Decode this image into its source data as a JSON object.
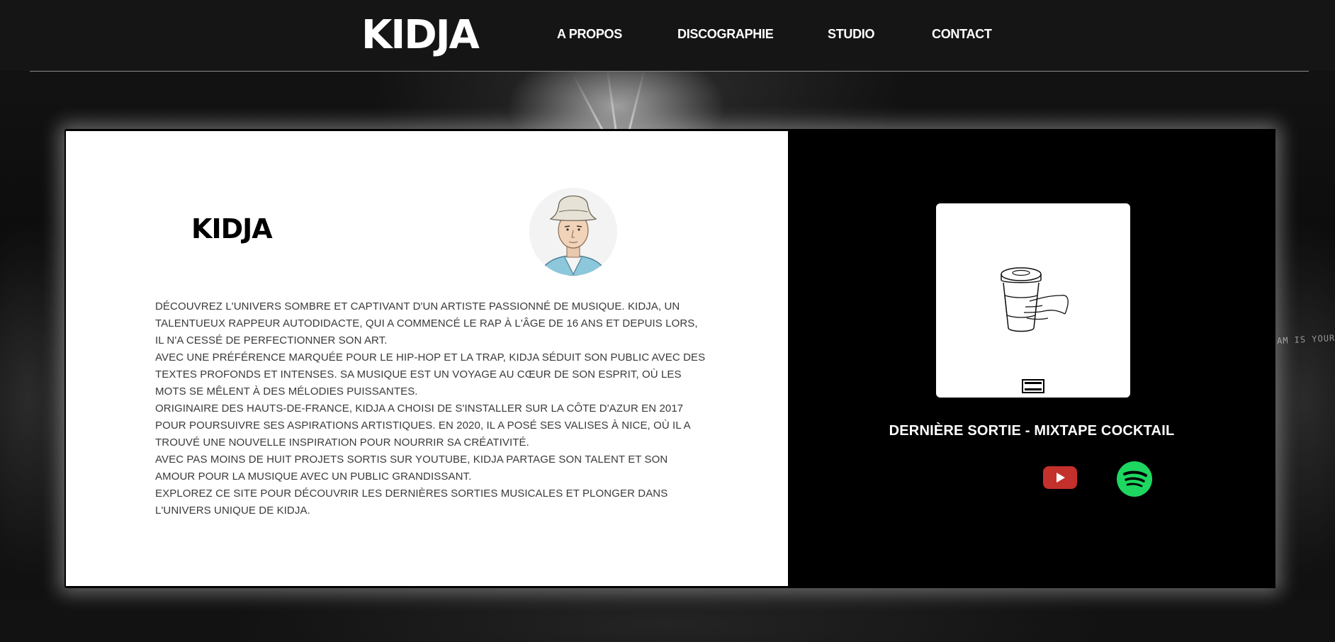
{
  "header": {
    "logo": "KIDJA",
    "nav": [
      {
        "label": "A PROPOS"
      },
      {
        "label": "DISCOGRAPHIE"
      },
      {
        "label": "STUDIO"
      },
      {
        "label": "CONTACT"
      }
    ]
  },
  "background": {
    "caption": "AM IS YOUR"
  },
  "about": {
    "title": "KIDJA",
    "paragraphs": [
      "DÉCOUVREZ L'UNIVERS SOMBRE ET CAPTIVANT D'UN ARTISTE PASSIONNÉ DE MUSIQUE. KIDJA, UN TALENTUEUX RAPPEUR AUTODIDACTE, QUI A COMMENCÉ LE RAP À L'ÂGE DE 16 ANS ET DEPUIS LORS, IL N'A CESSÉ DE PERFECTIONNER SON ART.",
      "AVEC UNE PRÉFÉRENCE MARQUÉE POUR LE HIP-HOP ET LA TRAP, KIDJA SÉDUIT SON PUBLIC AVEC DES TEXTES PROFONDS ET INTENSES. SA MUSIQUE EST UN VOYAGE AU CŒUR DE SON ESPRIT, OÙ LES MOTS SE MÊLENT À DES MÉLODIES PUISSANTES.",
      "ORIGINAIRE DES HAUTS-DE-FRANCE, KIDJA A CHOISI DE S'INSTALLER SUR LA CÔTE D'AZUR EN 2017 POUR POURSUIVRE SES ASPIRATIONS ARTISTIQUES. EN 2020, IL A POSÉ SES VALISES À NICE, OÙ IL A TROUVÉ UNE NOUVELLE INSPIRATION POUR NOURRIR SA CRÉATIVITÉ.",
      "AVEC PAS MOINS DE HUIT PROJETS SORTIS SUR YOUTUBE, KIDJA PARTAGE SON TALENT ET SON AMOUR POUR LA MUSIQUE AVEC UN PUBLIC GRANDISSANT.",
      "EXPLOREZ CE SITE POUR DÉCOUVRIR LES DERNIÈRES SORTIES MUSICALES ET PLONGER DANS L'UNIVERS UNIQUE DE KIDJA."
    ]
  },
  "release": {
    "title": "DERNIÈRE SORTIE - MIXTAPE COCKTAIL",
    "links": [
      {
        "icon": "youtube-icon",
        "color": "#c4302b"
      },
      {
        "icon": "spotify-icon",
        "color": "#1ed760"
      }
    ]
  },
  "colors": {
    "header_bg": "#151515",
    "panel_light": "#ffffff",
    "panel_dark": "#000000",
    "text_body": "#3a3a3a"
  }
}
